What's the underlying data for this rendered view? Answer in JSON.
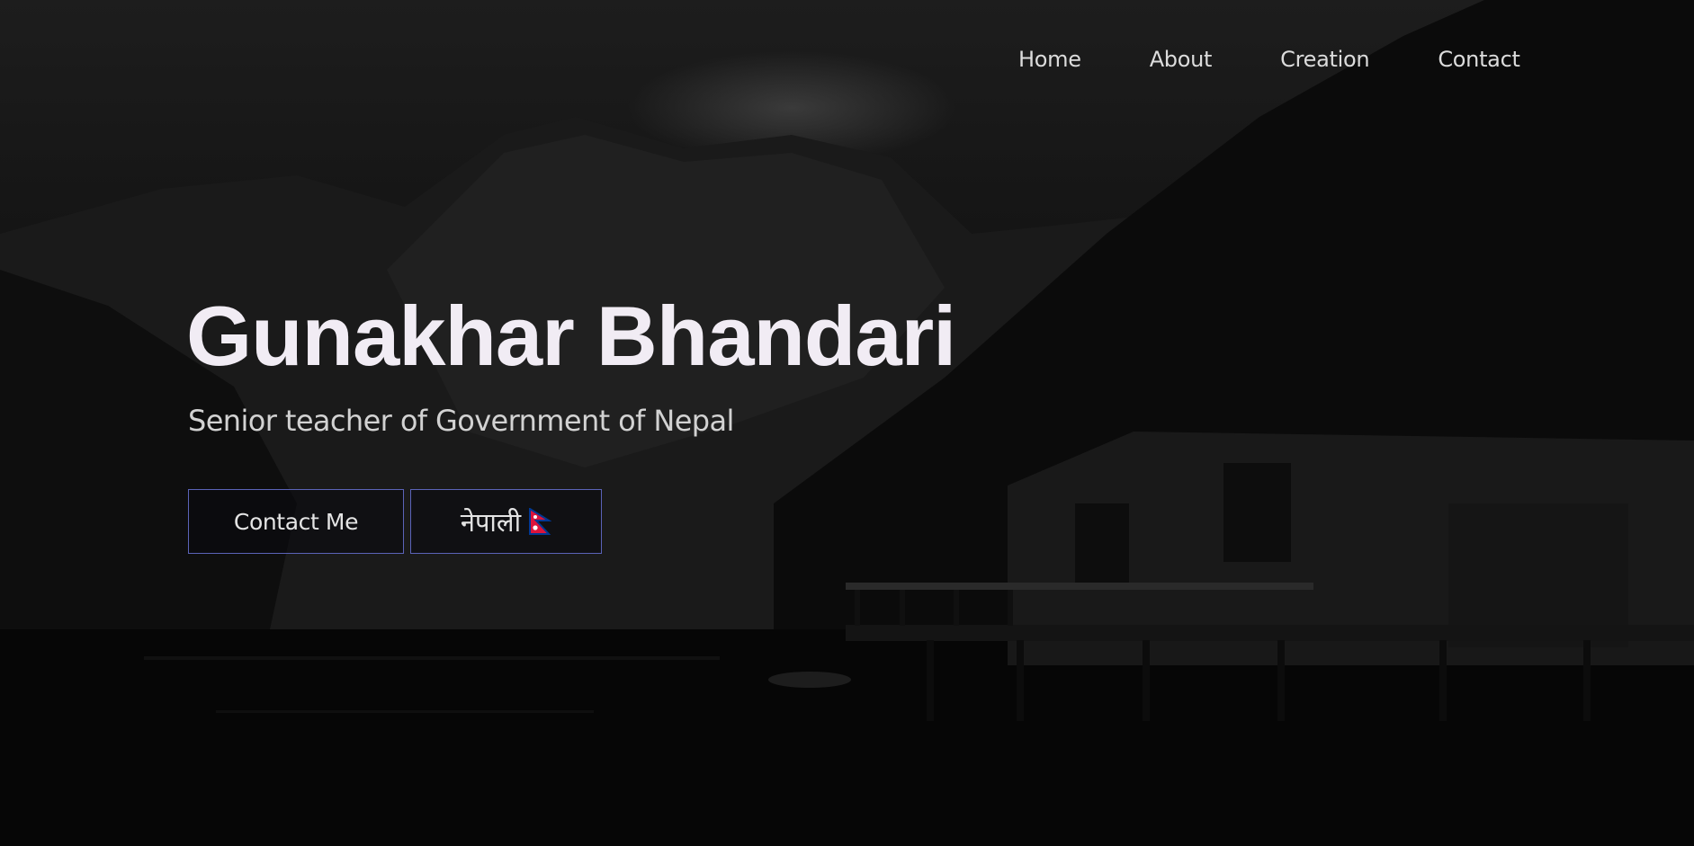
{
  "nav": {
    "items": [
      {
        "label": "Home"
      },
      {
        "label": "About"
      },
      {
        "label": "Creation"
      },
      {
        "label": "Contact"
      }
    ]
  },
  "hero": {
    "title": "Gunakhar Bhandari",
    "subtitle": "Senior teacher of Government of Nepal",
    "contact_button": "Contact Me",
    "language_button": "नेपाली",
    "language_flag_icon": "nepal-flag-icon"
  },
  "colors": {
    "title": "#f1ecf4",
    "button_border": "#5b63b8",
    "flag_red": "#dc143c",
    "flag_blue": "#003893"
  }
}
